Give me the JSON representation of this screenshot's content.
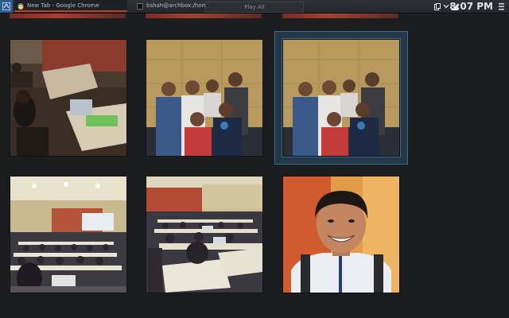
{
  "panel": {
    "tasks": [
      {
        "label": "New Tab - Google Chrome",
        "icon": "chrome-icon"
      },
      {
        "label": "bshah@archbox:/home/bshah",
        "icon": "terminal-icon"
      }
    ],
    "play_all_label": "Play All",
    "clock": "8:07 PM"
  },
  "gallery": {
    "selected_index": 2,
    "photos": [
      {
        "name": "classroom-students-laptops-photo"
      },
      {
        "name": "group-photo-six-people"
      },
      {
        "name": "group-photo-six-people-duplicate"
      },
      {
        "name": "auditorium-presentation-photo"
      },
      {
        "name": "auditorium-laptops-rows-photo"
      },
      {
        "name": "smiling-man-portrait-photo"
      }
    ]
  },
  "colors": {
    "accent": "#3a6b8b",
    "panel": "#2e3136",
    "background": "#1c1d1f"
  }
}
